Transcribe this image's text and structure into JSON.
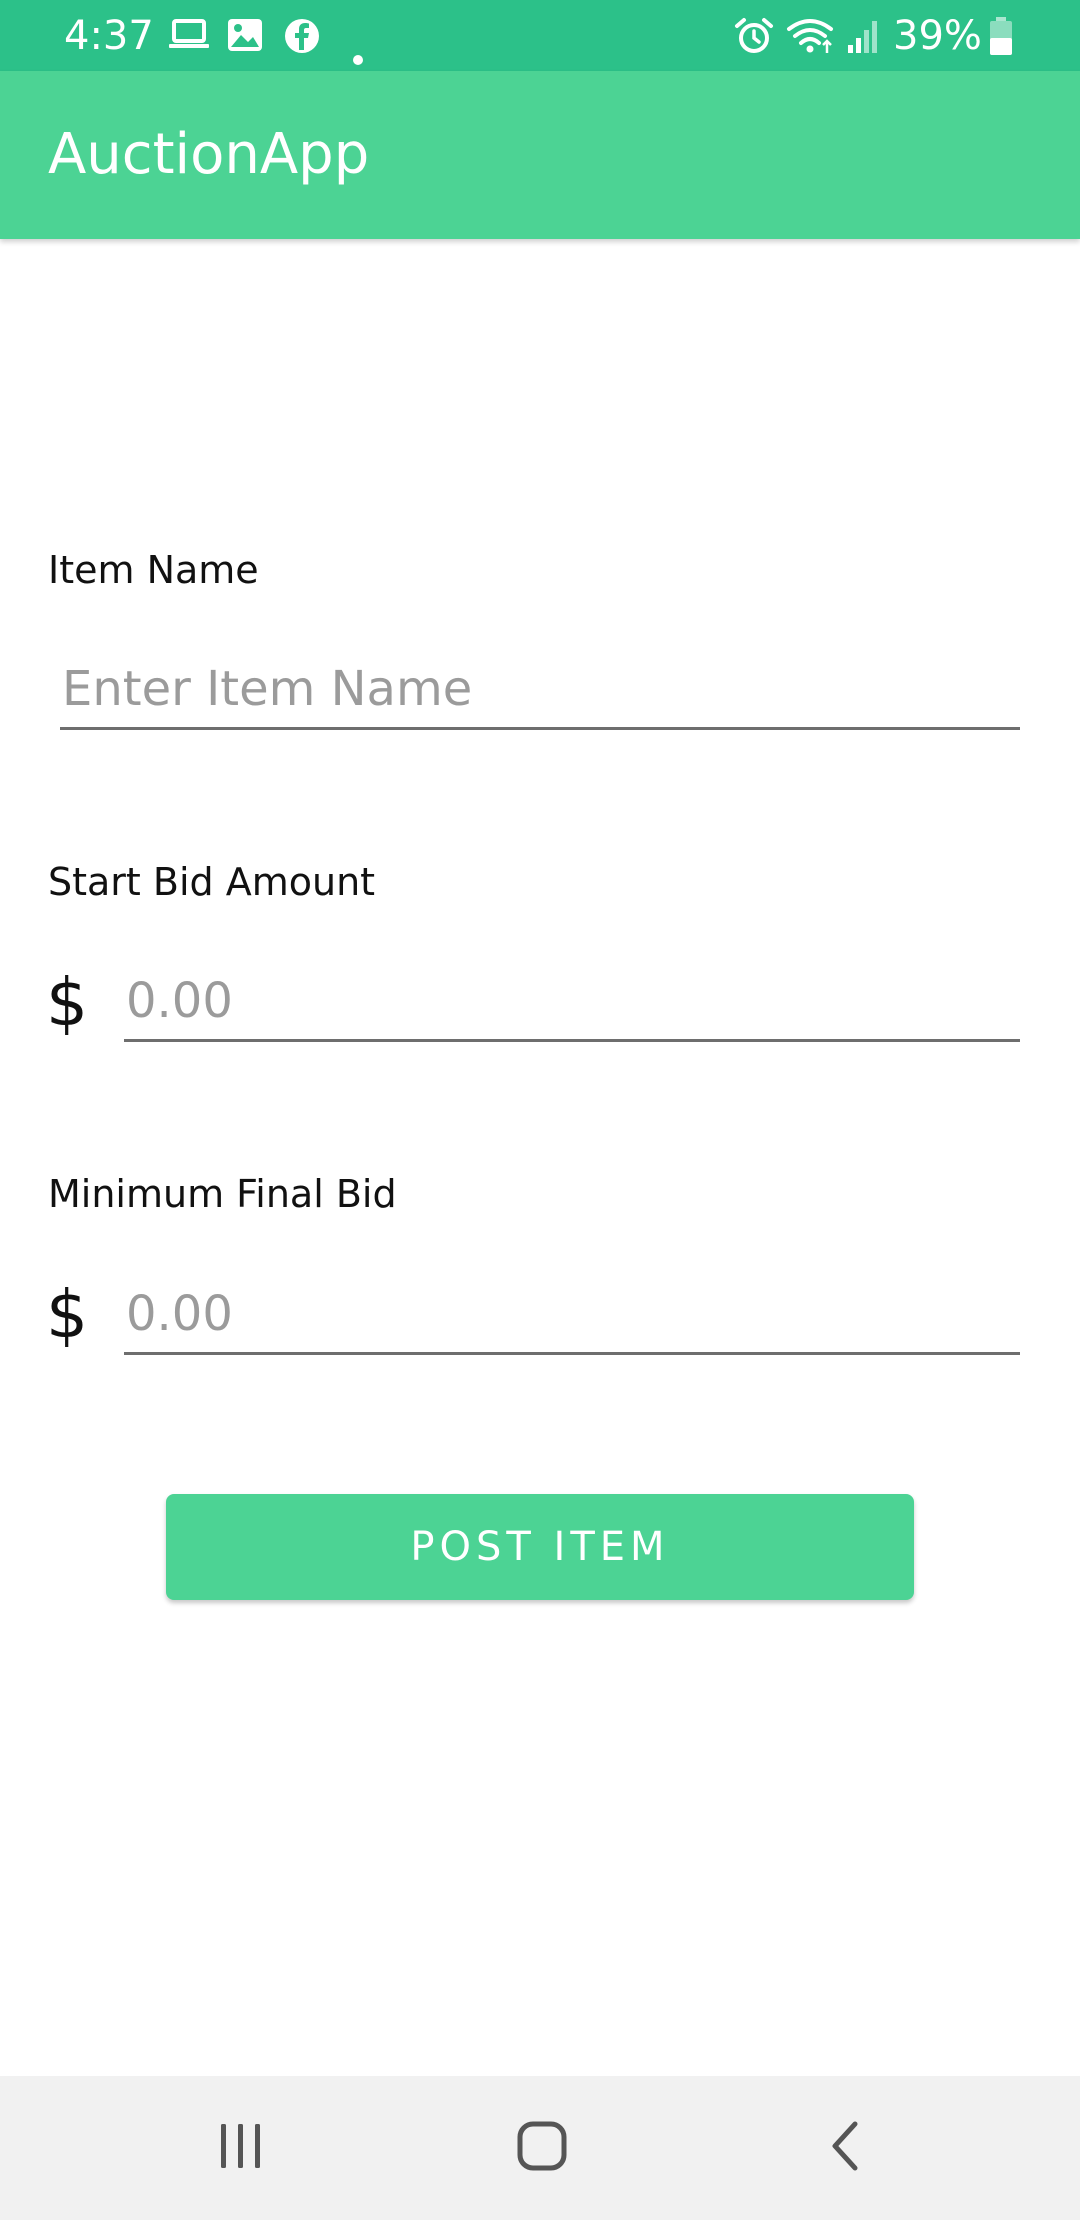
{
  "status_bar": {
    "time": "4:37",
    "battery": "39%",
    "icons": [
      "laptop-icon",
      "image-icon",
      "facebook-icon",
      "dot-icon",
      "alarm-icon",
      "wifi-icon",
      "signal-icon",
      "battery-icon"
    ]
  },
  "app_bar": {
    "title": "AuctionApp"
  },
  "form": {
    "item_name": {
      "label": "Item Name",
      "placeholder": "Enter Item Name",
      "value": ""
    },
    "start_bid": {
      "label": "Start Bid Amount",
      "currency": "$",
      "placeholder": "0.00",
      "value": ""
    },
    "min_final_bid": {
      "label": "Minimum Final Bid",
      "currency": "$",
      "placeholder": "0.00",
      "value": ""
    },
    "submit_label": "POST ITEM"
  },
  "nav_bar": {
    "buttons": [
      "recent-apps-icon",
      "home-icon",
      "back-icon"
    ]
  },
  "colors": {
    "status_bar": "#2cc189",
    "accent": "#4cd394",
    "nav_bar": "#f1f1f1"
  }
}
